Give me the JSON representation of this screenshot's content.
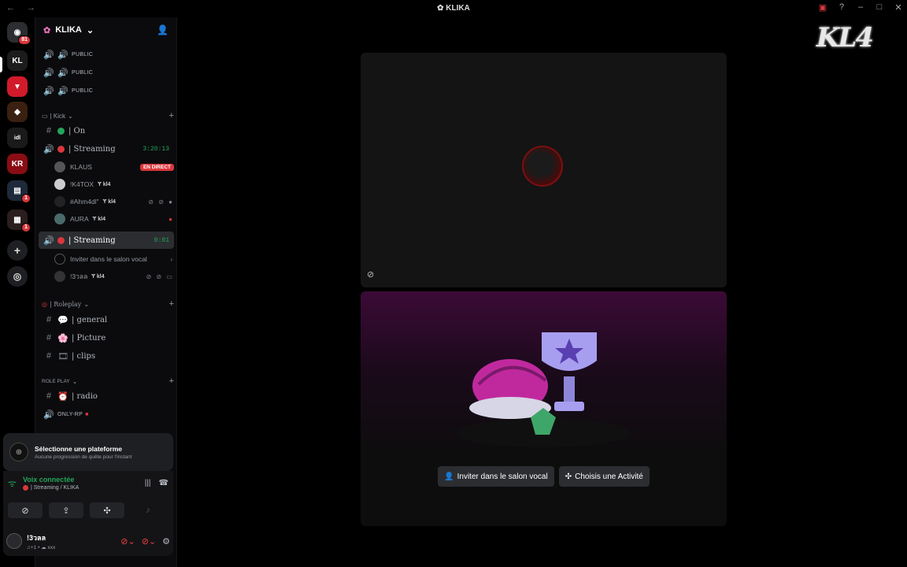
{
  "window": {
    "title": "KLIKA",
    "nav": "← →",
    "controls": [
      "▣",
      "?",
      "–",
      "□",
      "✕"
    ]
  },
  "rail": {
    "servers": [
      {
        "name": "discord-home",
        "label": "◉",
        "color": "#2b2d31",
        "badge": "81"
      },
      {
        "name": "server-kl4",
        "label": "KL",
        "color": "#1c1c1c",
        "badge": ""
      },
      {
        "name": "server-shield",
        "label": "▼",
        "color": "#d11a2a",
        "badge": ""
      },
      {
        "name": "server-fox",
        "label": "◆",
        "color": "#3a2010",
        "badge": ""
      },
      {
        "name": "server-text",
        "label": "idl",
        "color": "#1a1a1a",
        "badge": ""
      },
      {
        "name": "server-red",
        "label": "KR",
        "color": "#8a0d14",
        "badge": ""
      },
      {
        "name": "server-folder",
        "label": "▤",
        "color": "#1e2a3a",
        "badge": "1"
      },
      {
        "name": "server-folder-2",
        "label": "▦",
        "color": "#2a1e1e",
        "badge": "1"
      }
    ],
    "add_label": "+",
    "discover_label": "◎"
  },
  "server_header": {
    "name": "KLIKA",
    "chevron": "⌄",
    "icon": "✿",
    "invite_icon": "👤"
  },
  "top_channels": [
    {
      "icon": "🔊",
      "label": "PUBLIC"
    },
    {
      "icon": "🔊",
      "label": "PUBLIC"
    },
    {
      "icon": "🔊",
      "label": "PUBLIC"
    }
  ],
  "cat_kick": {
    "label": "| Kick",
    "chevron": "⌄",
    "plus": "+"
  },
  "kick_channels": [
    {
      "hash": "#",
      "label": "| On",
      "dot": "#23a55a"
    },
    {
      "hash": "🔊",
      "label": "| Streaming",
      "dot": "#da373c",
      "timer": "3:20:13"
    }
  ],
  "streaming_users": [
    {
      "name": "KLAUS",
      "tag": "",
      "live": "EN DIRECT",
      "icons": ""
    },
    {
      "name": "!K4TOX",
      "tag": "Ɏ kl4",
      "live": "",
      "icons": ""
    },
    {
      "name": "#Ahm4dl\"",
      "tag": "Ɏ kl4",
      "live": "",
      "icons": "⊘ ⊘ ●"
    },
    {
      "name": "AURA",
      "tag": "Ɏ kl4",
      "live": "",
      "icons": "●"
    }
  ],
  "active_channel": {
    "hash": "🔊",
    "label": "| Streaming",
    "dot": "#da373c",
    "timer": "0:01"
  },
  "invite_row": {
    "label": "Inviter dans le salon vocal",
    "chevron": "›"
  },
  "me_in_channel": {
    "name": "!3วลล",
    "tag": "Ɏ kl4",
    "icons": "⊘ ⊘ ▭"
  },
  "cat_roleplay": {
    "label": "| Roleplay",
    "chevron": "⌄",
    "plus": "+"
  },
  "roleplay_channels": [
    {
      "hash": "#",
      "emoji": "💬",
      "label": "| general"
    },
    {
      "hash": "#",
      "emoji": "🌸",
      "label": "| Picture"
    },
    {
      "hash": "#",
      "emoji": "🎞",
      "label": "| clips"
    }
  ],
  "cat_role_play": {
    "label": "ROLE PLAY",
    "chevron": "⌄",
    "plus": "+"
  },
  "rp_channels": [
    {
      "hash": "#",
      "emoji": "⏰",
      "label": "| radio"
    },
    {
      "hash": "🔊",
      "emoji": "",
      "label": "ONLY-RP"
    }
  ],
  "quest": {
    "title": "Sélectionne une plateforme",
    "subtitle": "Aucune progression de quête pour l'instant",
    "icon": "⊕"
  },
  "voice": {
    "status": "Voix connectée",
    "channel": "| Streaming / KLIKA",
    "buttons": [
      {
        "name": "camera-off-button",
        "icon": "⊘"
      },
      {
        "name": "screen-share-button",
        "icon": "⇪"
      },
      {
        "name": "activity-button",
        "icon": "✣"
      },
      {
        "name": "soundboard-button",
        "icon": "♪"
      }
    ]
  },
  "me": {
    "name": "!3วลล",
    "status": "♫+1 • ☁ xxx",
    "settings": "⚙"
  },
  "stage": {
    "invite_btn": "Inviter dans le salon vocal",
    "activity_btn": "Choisis une Activité"
  },
  "brand_logo": "KL4"
}
